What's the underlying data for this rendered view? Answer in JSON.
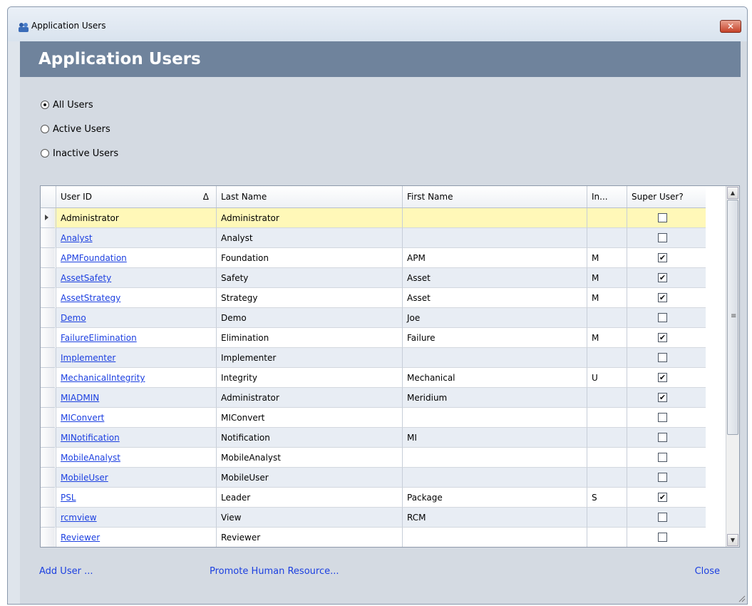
{
  "window": {
    "title": "Application Users",
    "close_symbol": "✕"
  },
  "banner": {
    "title": "Application Users"
  },
  "filters": [
    {
      "label": "All Users",
      "checked": true
    },
    {
      "label": "Active Users",
      "checked": false
    },
    {
      "label": "Inactive Users",
      "checked": false
    }
  ],
  "grid": {
    "columns": [
      "User ID",
      "Last Name",
      "First Name",
      "In...",
      "Super User?"
    ],
    "sort_symbol": "Δ",
    "rows": [
      {
        "user_id": "Administrator",
        "last": "Administrator",
        "first": "",
        "initial": "",
        "super": false,
        "current": true
      },
      {
        "user_id": "Analyst",
        "last": "Analyst",
        "first": "",
        "initial": "",
        "super": false
      },
      {
        "user_id": "APMFoundation",
        "last": "Foundation",
        "first": "APM",
        "initial": "M",
        "super": true
      },
      {
        "user_id": "AssetSafety",
        "last": "Safety",
        "first": "Asset",
        "initial": "M",
        "super": true
      },
      {
        "user_id": "AssetStrategy",
        "last": "Strategy",
        "first": "Asset",
        "initial": "M",
        "super": true
      },
      {
        "user_id": "Demo",
        "last": "Demo",
        "first": "Joe",
        "initial": "",
        "super": false
      },
      {
        "user_id": "FailureElimination",
        "last": "Elimination",
        "first": "Failure",
        "initial": "M",
        "super": true
      },
      {
        "user_id": "Implementer",
        "last": "Implementer",
        "first": "",
        "initial": "",
        "super": false
      },
      {
        "user_id": "MechanicalIntegrity",
        "last": "Integrity",
        "first": "Mechanical",
        "initial": "U",
        "super": true
      },
      {
        "user_id": "MIADMIN",
        "last": "Administrator",
        "first": "Meridium",
        "initial": "",
        "super": true
      },
      {
        "user_id": "MIConvert",
        "last": "MIConvert",
        "first": "",
        "initial": "",
        "super": false
      },
      {
        "user_id": "MINotification",
        "last": "Notification",
        "first": "MI",
        "initial": "",
        "super": false
      },
      {
        "user_id": "MobileAnalyst",
        "last": "MobileAnalyst",
        "first": "",
        "initial": "",
        "super": false
      },
      {
        "user_id": "MobileUser",
        "last": "MobileUser",
        "first": "",
        "initial": "",
        "super": false
      },
      {
        "user_id": "PSL",
        "last": "Leader",
        "first": "Package",
        "initial": "S",
        "super": true
      },
      {
        "user_id": "rcmview",
        "last": "View",
        "first": "RCM",
        "initial": "",
        "super": false
      },
      {
        "user_id": "Reviewer",
        "last": "Reviewer",
        "first": "",
        "initial": "",
        "super": false
      }
    ]
  },
  "footer": {
    "add_user": "Add User ...",
    "promote": "Promote Human Resource...",
    "close": "Close"
  },
  "colors": {
    "banner": "#6f839c",
    "selected_row": "#fff8b8",
    "alt_row": "#e8edf4",
    "link": "#1b3fe0"
  }
}
